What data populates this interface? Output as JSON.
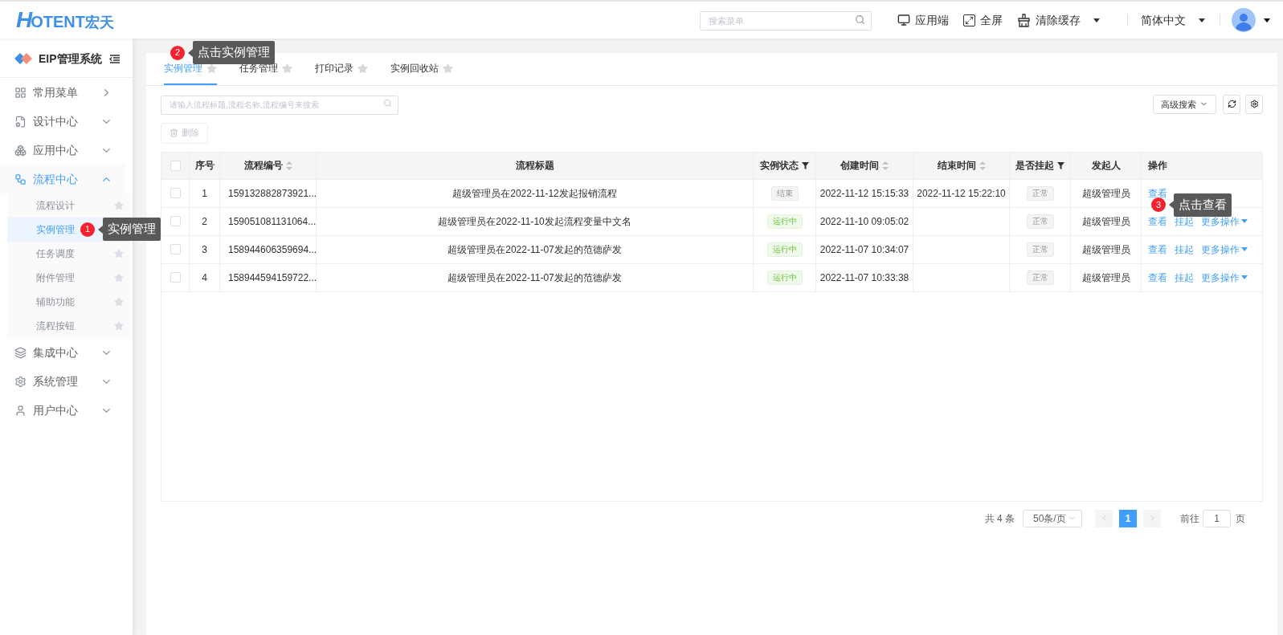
{
  "header": {
    "logo": {
      "letter": "H",
      "text": "OTENT",
      "cn": "宏天"
    },
    "search": {
      "placeholder": "搜索菜单"
    },
    "actions": [
      {
        "kind": "monitor",
        "label": "应用端",
        "dropdown": false
      },
      {
        "kind": "fullscreen",
        "label": "全屏",
        "dropdown": false
      },
      {
        "kind": "broom",
        "label": "清除缓存",
        "dropdown": true
      },
      {
        "kind": "language",
        "label": "简体中文",
        "dropdown": true
      }
    ]
  },
  "sidebar": {
    "title": "EIP管理系统",
    "items": [
      {
        "label": "常用菜单",
        "expanded": false
      },
      {
        "label": "设计中心",
        "expanded": false
      },
      {
        "label": "应用中心",
        "expanded": false
      },
      {
        "label": "流程中心",
        "expanded": true,
        "children": [
          {
            "label": "流程设计",
            "selected": false
          },
          {
            "label": "实例管理",
            "selected": true
          },
          {
            "label": "任务调度",
            "selected": false
          },
          {
            "label": "附件管理",
            "selected": false
          },
          {
            "label": "辅助功能",
            "selected": false
          },
          {
            "label": "流程按钮",
            "selected": false
          }
        ]
      },
      {
        "label": "集成中心",
        "expanded": false
      },
      {
        "label": "系统管理",
        "expanded": false
      },
      {
        "label": "用户中心",
        "expanded": false
      }
    ]
  },
  "tabs": [
    {
      "label": "实例管理",
      "selected": true
    },
    {
      "label": "任务管理",
      "selected": false
    },
    {
      "label": "打印记录",
      "selected": false
    },
    {
      "label": "实例回收站",
      "selected": false
    }
  ],
  "toolbar": {
    "search": {
      "placeholder": "请输入流程标题,流程名称,流程编号来搜索"
    },
    "advanced_search": "高级搜索",
    "delete": {
      "label": "删除",
      "disabled": true
    }
  },
  "table": {
    "select_all_checked": false,
    "columns": [
      {
        "kind": "check"
      },
      {
        "label": "序号",
        "kind": "plain"
      },
      {
        "label": "流程编号",
        "kind": "sort"
      },
      {
        "label": "流程标题",
        "kind": "plain"
      },
      {
        "label": "实例状态",
        "kind": "filter"
      },
      {
        "label": "创建时间",
        "kind": "sort"
      },
      {
        "label": "结束时间",
        "kind": "sort"
      },
      {
        "label": "是否挂起",
        "kind": "filter"
      },
      {
        "label": "发起人",
        "kind": "plain"
      },
      {
        "label": "操作",
        "kind": "plain"
      }
    ],
    "rows": [
      {
        "checked": false,
        "index": "1",
        "number": "159132882873921...",
        "title": "超级管理员在2022-11-12发起报销流程",
        "status": {
          "label": "结束",
          "kind": "ended"
        },
        "created": "2022-11-12 15:15:33",
        "ended": "2022-11-12 15:22:10",
        "suspended": "正常",
        "initiator": "超级管理员",
        "actions": [
          {
            "label": "查看",
            "dropdown": false
          }
        ]
      },
      {
        "checked": false,
        "index": "2",
        "number": "159051081131064...",
        "title": "超级管理员在2022-11-10发起流程变量中文名",
        "status": {
          "label": "运行中",
          "kind": "running"
        },
        "created": "2022-11-10 09:05:02",
        "ended": "",
        "suspended": "正常",
        "initiator": "超级管理员",
        "actions": [
          {
            "label": "查看",
            "dropdown": false
          },
          {
            "label": "挂起",
            "dropdown": false
          },
          {
            "label": "更多操作",
            "dropdown": true
          }
        ]
      },
      {
        "checked": false,
        "index": "3",
        "number": "158944606359694...",
        "title": "超级管理员在2022-11-07发起的范德萨发",
        "status": {
          "label": "运行中",
          "kind": "running"
        },
        "created": "2022-11-07 10:34:07",
        "ended": "",
        "suspended": "正常",
        "initiator": "超级管理员",
        "actions": [
          {
            "label": "查看",
            "dropdown": false
          },
          {
            "label": "挂起",
            "dropdown": false
          },
          {
            "label": "更多操作",
            "dropdown": true
          }
        ]
      },
      {
        "checked": false,
        "index": "4",
        "number": "158944594159722...",
        "title": "超级管理员在2022-11-07发起的范德萨发",
        "status": {
          "label": "运行中",
          "kind": "running"
        },
        "created": "2022-11-07 10:33:38",
        "ended": "",
        "suspended": "正常",
        "initiator": "超级管理员",
        "actions": [
          {
            "label": "查看",
            "dropdown": false
          },
          {
            "label": "挂起",
            "dropdown": false
          },
          {
            "label": "更多操作",
            "dropdown": true
          }
        ]
      }
    ]
  },
  "pagination": {
    "total": "共 4 条",
    "page_size": "50条/页",
    "pages": [
      {
        "label": "1",
        "selected": true
      }
    ],
    "goto": "前往",
    "goto_value": "1",
    "goto_unit": "页"
  },
  "callouts": [
    {
      "number": "1",
      "text": "实例管理"
    },
    {
      "number": "2",
      "text": "点击实例管理"
    },
    {
      "number": "3",
      "text": "点击查看"
    }
  ]
}
